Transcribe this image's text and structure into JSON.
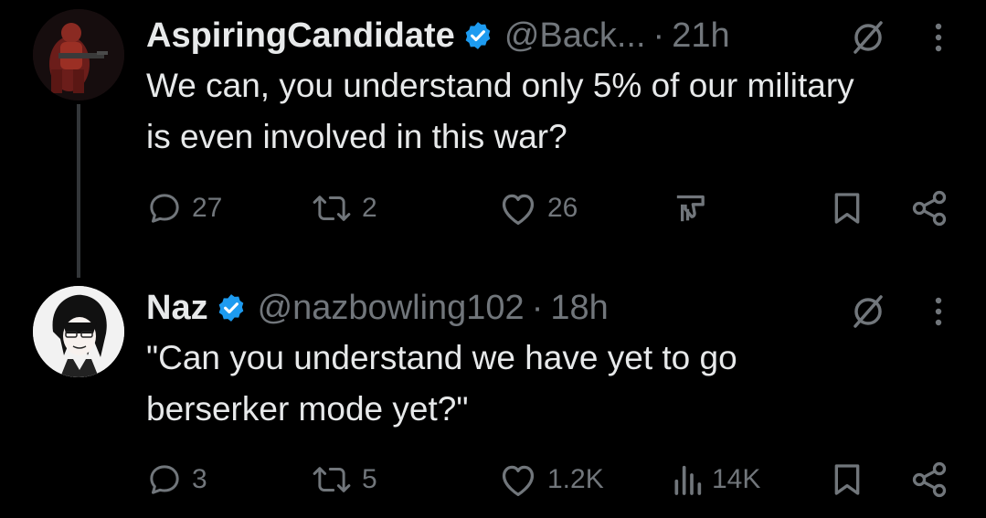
{
  "colors": {
    "background": "#000000",
    "text_primary": "#e7e9ea",
    "text_secondary": "#71767b",
    "verified_badge": "#1d9bf0",
    "thread_line": "#333639"
  },
  "tweets": [
    {
      "display_name": "AspiringCandidate",
      "verified": true,
      "handle": "@Back...",
      "separator": "·",
      "time": "21h",
      "text": "We can, you understand only 5% of our military is even involved in this war?",
      "actions": {
        "reply_count": "27",
        "retweet_count": "2",
        "like_count": "26",
        "middle_icon": "thumbs-down-icon",
        "middle_count": ""
      },
      "icons": [
        "grok-icon",
        "more-icon",
        "reply-icon",
        "retweet-icon",
        "like-icon",
        "thumbs-down-icon",
        "bookmark-icon",
        "share-icon"
      ]
    },
    {
      "display_name": "Naz",
      "verified": true,
      "handle": "@nazbowling102",
      "separator": "·",
      "time": "18h",
      "text": "\"Can you understand we have yet to go berserker mode yet?\"",
      "actions": {
        "reply_count": "3",
        "retweet_count": "5",
        "like_count": "1.2K",
        "middle_icon": "views-icon",
        "middle_count": "14K"
      },
      "icons": [
        "grok-icon",
        "more-icon",
        "reply-icon",
        "retweet-icon",
        "like-icon",
        "views-icon",
        "bookmark-icon",
        "share-icon"
      ]
    }
  ]
}
